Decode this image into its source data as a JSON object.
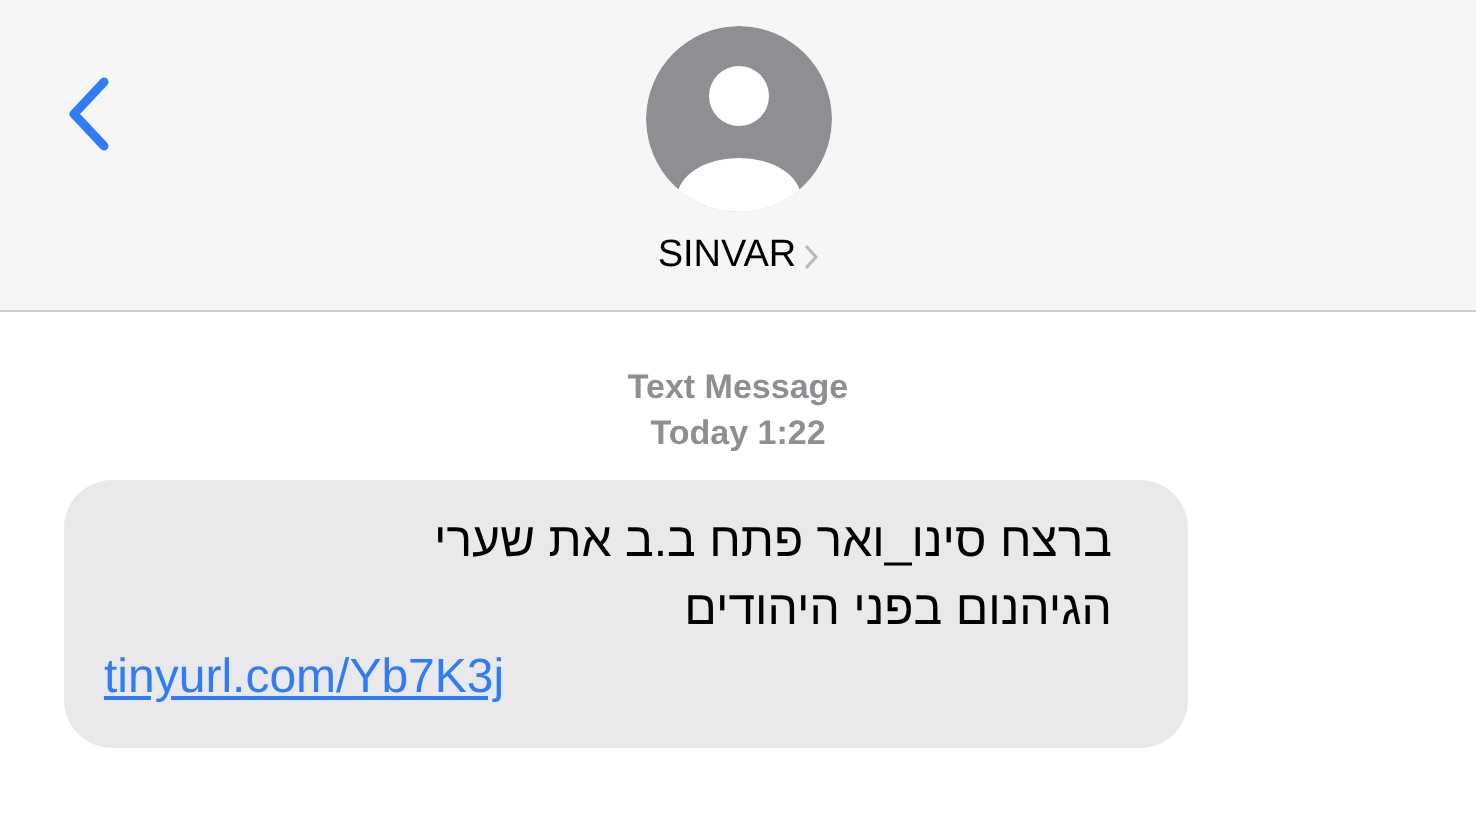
{
  "header": {
    "contact_name": "SINVAR"
  },
  "thread": {
    "service_label": "Text Message",
    "timestamp": "Today 1:22"
  },
  "messages": [
    {
      "kind": "incoming",
      "text": "ברצח סינו_ואר פתח ב.ב את שערי\nהגיהנום בפני היהודים",
      "link": "tinyurl.com/Yb7K3j"
    }
  ]
}
